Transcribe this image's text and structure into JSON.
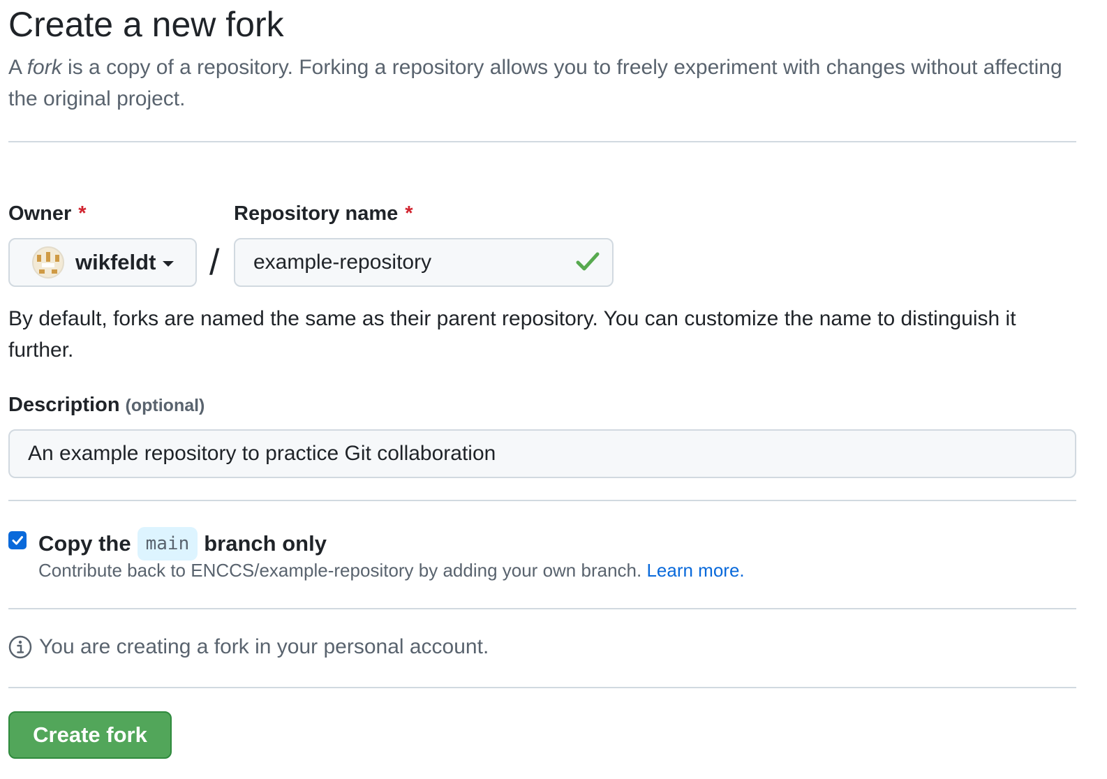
{
  "header": {
    "title": "Create a new fork",
    "intro_prefix": "A ",
    "intro_emphasis": "fork",
    "intro_rest": " is a copy of a repository. Forking a repository allows you to freely experiment with changes without affecting the original project."
  },
  "owner": {
    "label": "Owner",
    "required_mark": "*",
    "selected": "wikfeldt",
    "avatar_icon": "identicon-avatar"
  },
  "separator": "/",
  "repository": {
    "label": "Repository name",
    "required_mark": "*",
    "value": "example-repository",
    "status_icon": "check-icon",
    "status_color": "#57a94f",
    "hint": "By default, forks are named the same as their parent repository. You can customize the name to distinguish it further."
  },
  "description": {
    "label": "Description",
    "optional": "(optional)",
    "value": "An example repository to practice Git collaboration"
  },
  "copy_branch": {
    "checked": true,
    "label_prefix": "Copy the",
    "branch": "main",
    "label_suffix": "branch only",
    "sub_text": "Contribute back to ENCCS/example-repository by adding your own branch.",
    "learn_more": "Learn more."
  },
  "info": {
    "icon": "info-icon",
    "text": "You are creating a fork in your personal account."
  },
  "submit": {
    "label": "Create fork",
    "color": "#52a65a"
  }
}
